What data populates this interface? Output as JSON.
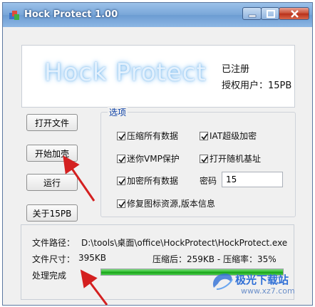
{
  "window": {
    "title": "Hock Protect 1.00"
  },
  "banner": {
    "logo": "Hock Protect",
    "registration_status": "已注册",
    "licensed_user": "授权用户：15PB"
  },
  "buttons": {
    "open_file": "打开文件",
    "start_pack": "开始加壳",
    "run": "运行",
    "about": "关于15PB"
  },
  "options": {
    "title": "选项",
    "compress_all": {
      "label": "压缩所有数据",
      "checked": true
    },
    "iat_encrypt": {
      "label": "IAT超级加密",
      "checked": true
    },
    "mini_vmp": {
      "label": "迷你VMP保护",
      "checked": true
    },
    "random_base": {
      "label": "打开随机基址",
      "checked": true
    },
    "encrypt_all": {
      "label": "加密所有数据",
      "checked": true
    },
    "repair_icon": {
      "label": "修复图标资源,版本信息",
      "checked": true
    },
    "password_label": "密码",
    "password_value": "15"
  },
  "info": {
    "path_label": "文件路径：",
    "path_value": "D:\\tools\\桌面\\office\\HockProtect\\HockProtect.exe",
    "size_label": "文件尺寸：",
    "size_value": "395KB",
    "compressed": "压缩后：259KB - 压缩率：35%",
    "status": "处理完成",
    "progress": 1.0
  },
  "watermark": {
    "text": "极光下载站",
    "url": "www.xz7.com"
  },
  "colors": {
    "group_title": "#0a3fa6",
    "progress": "#22b322",
    "arrow": "#d42020"
  }
}
